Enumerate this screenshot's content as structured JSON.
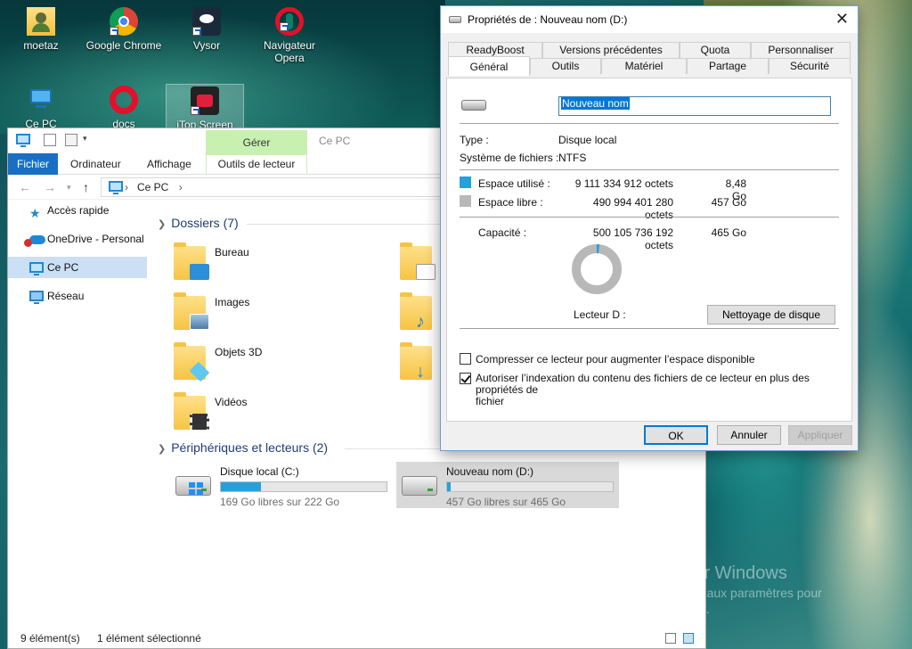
{
  "desktop": {
    "icons": [
      {
        "label": "moetaz"
      },
      {
        "label": "Google Chrome"
      },
      {
        "label": "Vysor"
      },
      {
        "label": "Navigateur Opera"
      },
      {
        "label": "Ce PC"
      },
      {
        "label": "docs"
      },
      {
        "label": "iTop Screen"
      }
    ],
    "activation": {
      "title": "Activer Windows",
      "line1": "Accédez aux paramètres pour",
      "line2": "Windows."
    }
  },
  "explorer": {
    "ribbon": {
      "context_group": "Gérer",
      "context_window_title": "Ce PC",
      "tabs": [
        "Fichier",
        "Ordinateur",
        "Affichage",
        "Outils de lecteur"
      ]
    },
    "address": {
      "path": "Ce PC",
      "separator": "›"
    },
    "nav": [
      {
        "label": "Accès rapide"
      },
      {
        "label": "OneDrive - Personal"
      },
      {
        "label": "Ce PC"
      },
      {
        "label": "Réseau"
      }
    ],
    "folders_header": "Dossiers (7)",
    "folders": [
      "Bureau",
      "Images",
      "Objets 3D",
      "Vidéos"
    ],
    "drives_header": "Périphériques et lecteurs (2)",
    "drives": [
      {
        "name": "Disque local (C:)",
        "free": "169 Go libres sur 222 Go",
        "used_fraction": 0.24
      },
      {
        "name": "Nouveau nom (D:)",
        "free": "457 Go libres sur 465 Go",
        "used_fraction": 0.02
      }
    ],
    "status": {
      "count": "9 élément(s)",
      "selected": "1 élément sélectionné"
    }
  },
  "dialog": {
    "title": "Propriétés de : Nouveau nom (D:)",
    "tabs_row1": [
      "ReadyBoost",
      "Versions précédentes",
      "Quota",
      "Personnaliser"
    ],
    "tabs_row2": [
      "Général",
      "Outils",
      "Matériel",
      "Partage",
      "Sécurité"
    ],
    "name_value": "Nouveau nom",
    "type_label": "Type :",
    "type_value": "Disque local",
    "fs_label": "Système de fichiers :",
    "fs_value": "NTFS",
    "used_label": "Espace utilisé :",
    "used_bytes": "9 111 334 912 octets",
    "used_go": "8,48 Go",
    "free_label": "Espace libre :",
    "free_bytes": "490 994 401 280 octets",
    "free_go": "457 Go",
    "cap_label": "Capacité :",
    "cap_bytes": "500 105 736 192 octets",
    "cap_go": "465 Go",
    "used_fraction": 0.018,
    "drive_label": "Lecteur D :",
    "cleanup_button": "Nettoyage de disque",
    "compress_label": "Compresser ce lecteur pour augmenter l’espace disponible",
    "compress_checked": false,
    "index_label_line1": "Autoriser l’indexation du contenu des fichiers de ce lecteur en plus des propriétés de",
    "index_label_line2": "fichier",
    "index_checked": true,
    "ok": "OK",
    "cancel": "Annuler",
    "apply": "Appliquer",
    "colors": {
      "used": "#26a0da",
      "free": "#b8b8b8"
    }
  }
}
